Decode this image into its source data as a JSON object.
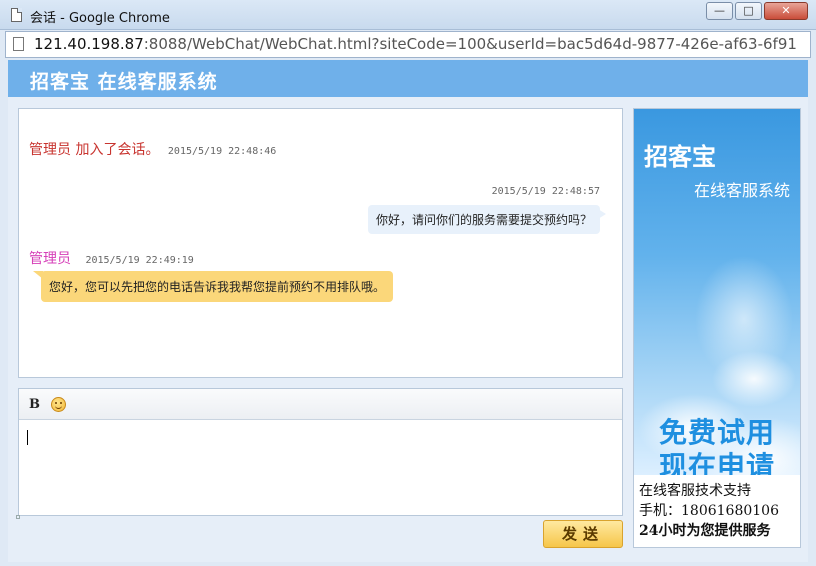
{
  "window": {
    "title": "会话 - Google Chrome",
    "btn_minimize": "—",
    "btn_maximize": "□",
    "btn_close": "✕"
  },
  "address": {
    "host": "121.40.198.87",
    "path": ":8088/WebChat/WebChat.html?siteCode=100&userId=bac5d64d-9877-426e-af63-6f91"
  },
  "header": {
    "brand": "招客宝 在线客服系统"
  },
  "chat": {
    "system_sender": "管理员",
    "system_text": "加入了会话。",
    "system_time": "2015/5/19 22:48:46",
    "user_time": "2015/5/19 22:48:57",
    "user_message": "你好，请问你们的服务需要提交预约吗？",
    "agent_name": "管理员",
    "agent_time": "2015/5/19 22:49:19",
    "agent_message": "您好，您可以先把您的电话告诉我我帮您提前预约不用排队哦。"
  },
  "composer": {
    "bold_label": "B",
    "input_value": ""
  },
  "send_label": "发送",
  "ad": {
    "brand": "招客宝",
    "subtitle": "在线客服系统",
    "promo_line1": "免费试用",
    "promo_line2": "现在申请",
    "support": "在线客服技术支持",
    "phone_label": "手机：",
    "phone": "18061680106",
    "service": "24小时为您提供服务"
  }
}
